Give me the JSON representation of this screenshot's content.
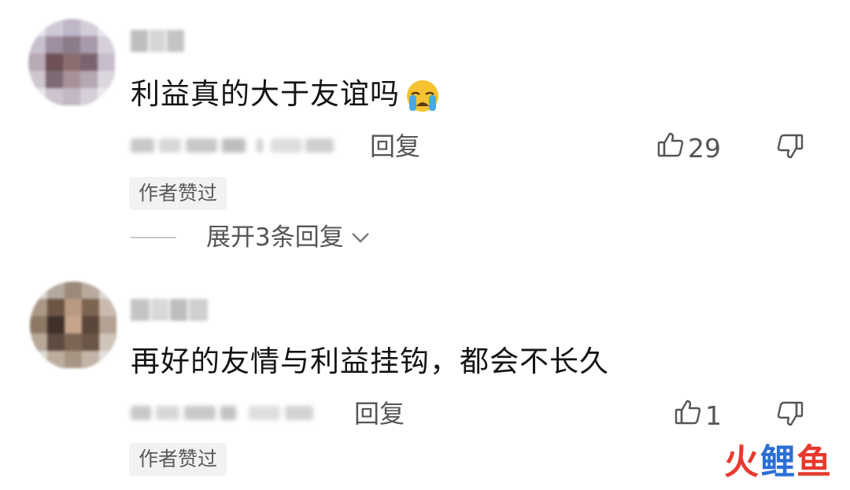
{
  "comments": [
    {
      "text": "利益真的大于友谊吗",
      "emoji": "loudly-crying-face",
      "reply_label": "回复",
      "likes": "29",
      "badge": "作者赞过",
      "expand_label": "展开3条回复"
    },
    {
      "text": "再好的友情与利益挂钩，都会不长久",
      "reply_label": "回复",
      "likes": "1",
      "badge": "作者赞过"
    }
  ],
  "watermark": {
    "char1": "火",
    "char2": "鲤",
    "char3": "鱼"
  },
  "colors": {
    "text": "#141414",
    "secondary": "#555555",
    "badge_bg": "#f2f2f2",
    "watermark_red": "#e8392e",
    "watermark_blue": "#2b6fd6"
  }
}
